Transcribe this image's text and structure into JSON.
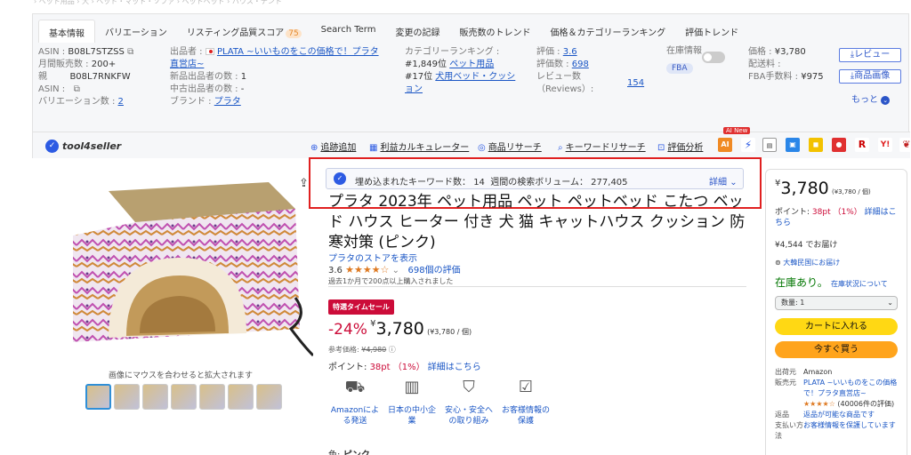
{
  "tabs": [
    "基本情報",
    "バリエーション",
    "リスティング品質スコア",
    "Search Term",
    "変更の記録",
    "販売数のトレンド",
    "価格＆カテゴリーランキング",
    "評価トレンド"
  ],
  "quality_score": "75",
  "info": {
    "asin_label": "ASIN :",
    "asin": "B08L7STZSS",
    "monthly_label": "月間販売数 :",
    "monthly": "200+",
    "parent_label": "親",
    "parent_asin": "B08L7RNKFW",
    "asin2_label": "ASIN :",
    "variation_label": "バリエーション数 :",
    "variation": "2",
    "seller_label": "出品者 :",
    "seller": "PLATA ~いいものをこの価格で！プラタ直営店~",
    "new_sellers_label": "新品出品者の数 :",
    "new_sellers": "1",
    "used_sellers_label": "中古出品者の数 :",
    "used_sellers": "-",
    "brand_label": "ブランド :",
    "brand": "プラタ",
    "rank_label": "カテゴリーランキング :",
    "rank1": "#1,849位",
    "rank1_cat": "ペット用品",
    "rank2": "#17位",
    "rank2_cat": "犬用ベッド・クッション",
    "rating_label": "評価 :",
    "rating": "3.6",
    "rating_count_label": "評価数 :",
    "rating_count": "698",
    "review_label": "レビュー数",
    "review_label2": "（Reviews）:",
    "review_count": "154",
    "stock_label": "在庫情報",
    "fba": "FBA",
    "price_label": "価格 :",
    "price": "¥3,780",
    "shipping_label": "配送料 :",
    "shipping": "",
    "fba_fee_label": "FBA手数料 :",
    "fba_fee": "¥975",
    "btn_review": "レビュー",
    "btn_image": "商品画像",
    "more": "もっと"
  },
  "toolbar": {
    "logo": "tool4seller",
    "tools": [
      "追跡追加",
      "利益カルキュレーター",
      "商品リサーチ",
      "キーワードリサーチ",
      "評価分析"
    ],
    "ai_new": "AI New"
  },
  "keywords": {
    "embedded_label": "埋め込まれたキーワード数：",
    "embedded": "14",
    "volume_label": "週間の検索ボリューム：",
    "volume": "277,405",
    "detail": "詳細"
  },
  "product": {
    "title": "プラタ 2023年 ペット用品 ペット ペットベッド こたつ ベッド ハウス ヒーター 付き 犬 猫 キャットハウス クッション 防寒対策 (ピンク)",
    "store": "プラタのストアを表示",
    "rating": "3.6",
    "stars": "★★★★☆",
    "ratings_count": "698個の評価",
    "bought": "過去1か月で200点以上購入されました",
    "sale_badge": "特選タイムセール",
    "discount": "-24%",
    "price_symbol": "¥",
    "price": "3,780",
    "unit_price": "(¥3,780 / 個)",
    "ref_label": "参考価格:",
    "ref_price": "¥4,980",
    "points_label": "ポイント:",
    "points": "38pt （1%）",
    "points_link": "詳細はこちら",
    "hover_text": "画像にマウスを合わせると拡大されます",
    "color_label": "色:",
    "color": "ピンク"
  },
  "features": [
    {
      "icon": "truck-icon",
      "label": "Amazonによる発送"
    },
    {
      "icon": "building-icon",
      "label": "日本の中小企業"
    },
    {
      "icon": "shield-icon",
      "label": "安心・安全への取り組み"
    },
    {
      "icon": "clipboard-icon",
      "label": "お客様情報の保護"
    }
  ],
  "buybox": {
    "price_symbol": "¥",
    "price": "3,780",
    "unit_price": "(¥3,780 / 個)",
    "points_label": "ポイント:",
    "points": "38pt （1%）",
    "points_link": "詳細はこちら",
    "delivery": "¥4,544 でお届け",
    "location": "大韓民国にお届け",
    "stock": "在庫あり。",
    "stock_link": "在庫状況について",
    "qty": "数量: 1",
    "add_cart": "カートに入れる",
    "buy_now": "今すぐ買う",
    "ship_from_label": "出荷元",
    "ship_from": "Amazon",
    "seller_label": "販売元",
    "seller": "PLATA ~いいものをこの価格で！プラタ直営店~",
    "seller_rating": "★★★★☆",
    "seller_count": "(40006件の評価)",
    "return_label": "返品",
    "return": "返品が可能な商品です",
    "payment_label": "支払い方法",
    "payment": "お客様情報を保護しています"
  },
  "colors": {
    "accent": "#2d5be3",
    "red": "#e02020",
    "orange": "#cc0c39",
    "cart": "#ffd814",
    "buy": "#ffa41c"
  }
}
